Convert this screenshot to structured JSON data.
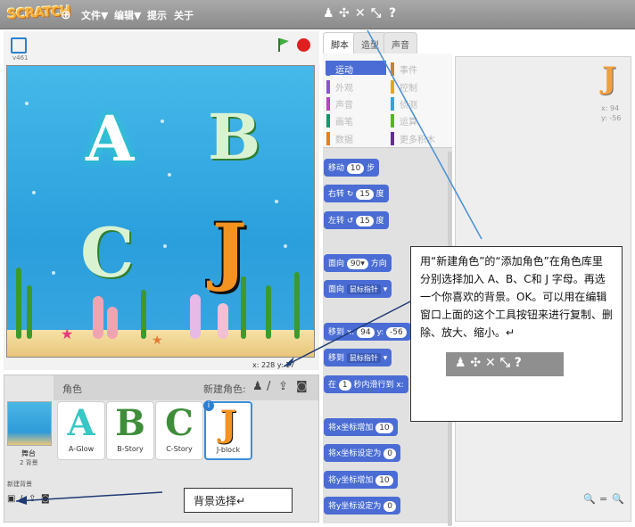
{
  "menubar": {
    "logo": "SCRATCH",
    "file": "文件▼",
    "edit": "编辑▼",
    "tips": "提示",
    "about": "关于",
    "tools": [
      "♟",
      "✣",
      "✕",
      "⤡",
      "?"
    ]
  },
  "stage": {
    "version": "v461",
    "coords": "x: 228  y: 17",
    "letters": [
      "A",
      "B",
      "C",
      "J"
    ]
  },
  "tabs": [
    "脚本",
    "造型",
    "声音"
  ],
  "categories": [
    {
      "label": "运动",
      "color": "#4a6cd4"
    },
    {
      "label": "事件",
      "color": "#c88330"
    },
    {
      "label": "外观",
      "color": "#8a55d7"
    },
    {
      "label": "控制",
      "color": "#e1a91a"
    },
    {
      "label": "声音",
      "color": "#bb42c3"
    },
    {
      "label": "侦测",
      "color": "#2ca5e2"
    },
    {
      "label": "画笔",
      "color": "#0e9a6c"
    },
    {
      "label": "运算",
      "color": "#5cb712"
    },
    {
      "label": "数据",
      "color": "#ee7d16"
    },
    {
      "label": "更多积木",
      "color": "#632d99"
    }
  ],
  "blocks": {
    "move": "移动",
    "move_steps": "10",
    "move_unit": "步",
    "turn_right": "右转",
    "turn_right_val": "15",
    "turn_right_unit": "度",
    "turn_left": "左转",
    "turn_left_val": "15",
    "turn_left_unit": "度",
    "point_dir": "面向",
    "point_dir_val": "90▾",
    "point_dir_unit": "方向",
    "point_towards": "面向",
    "point_towards_val": "鼠标指针",
    "goto_xy": "移到",
    "goto_xy_val_x": "94",
    "goto_xy_y": "y:",
    "goto_xy_val_y": "-56",
    "goto": "移到",
    "goto_val": "鼠标指针",
    "glide": "在",
    "glide_val": "1",
    "glide_text": "秒内滑行到 x:",
    "change_x": "将x坐标增加",
    "change_x_val": "10",
    "set_x": "将x坐标设定为",
    "set_x_val": "0",
    "change_y": "将y坐标增加",
    "change_y_val": "10",
    "set_y": "将y坐标设定为",
    "set_y_val": "0"
  },
  "script_area": {
    "sprite_letter": "J",
    "x": "x: 94",
    "y": "y: -56"
  },
  "sprites": {
    "title": "角色",
    "new_sprite": "新建角色:",
    "stage_label": "舞台",
    "stage_sub": "2 背景",
    "new_backdrop": "新建背景",
    "items": [
      {
        "letter": "A",
        "name": "A-Glow",
        "color": "#37c7c4"
      },
      {
        "letter": "B",
        "name": "B-Story",
        "color": "#3f8d3b"
      },
      {
        "letter": "C",
        "name": "C-Story",
        "color": "#3f8d3b"
      },
      {
        "letter": "J",
        "name": "J-block",
        "color": "#f39321"
      }
    ]
  },
  "callouts": {
    "main": "用“新建角色”的“添加角色”在角色库里分别选择加入 A、B、C和 J 字母。再选一个你喜欢的背景。OK。可以用在编辑窗口上面的这个工具按钮来进行复制、删除、放大、缩小。↵",
    "backdrop": "背景选择↵"
  },
  "zoom": [
    "🔍",
    "=",
    "🔍"
  ]
}
